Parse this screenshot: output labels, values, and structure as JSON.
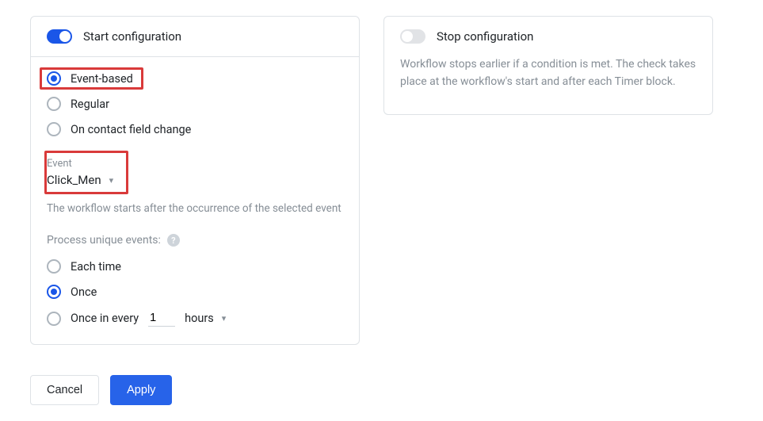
{
  "start_panel": {
    "title": "Start configuration",
    "toggle_on": true,
    "radios": {
      "event_based": "Event-based",
      "regular": "Regular",
      "on_contact_change": "On contact field change",
      "selected": "event_based"
    },
    "event_field": {
      "label": "Event",
      "value": "Click_Men",
      "helper": "The workflow starts after the occurrence of the selected event"
    },
    "process_unique": {
      "label": "Process unique events:",
      "each_time": "Each time",
      "once": "Once",
      "once_in_every": "Once in every",
      "interval_value": "1",
      "interval_unit": "hours",
      "selected": "once"
    }
  },
  "stop_panel": {
    "title": "Stop configuration",
    "toggle_on": false,
    "description": "Workflow stops earlier if a condition is met. The check takes place at the workflow's start and after each Timer block."
  },
  "buttons": {
    "cancel": "Cancel",
    "apply": "Apply"
  }
}
